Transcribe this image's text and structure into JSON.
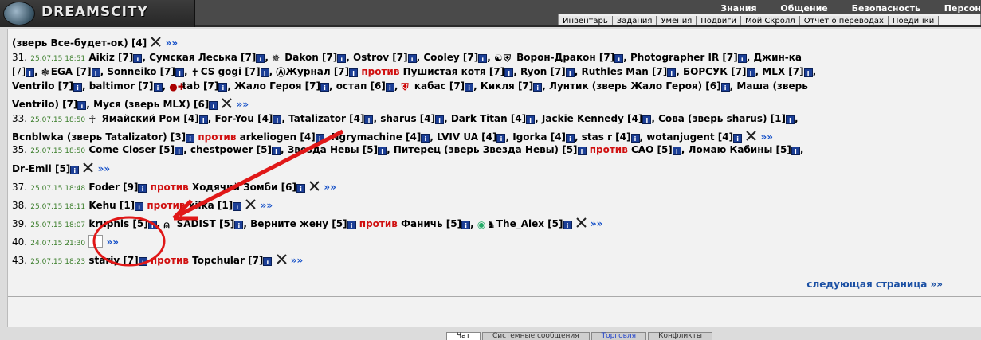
{
  "header": {
    "title": "DREAMSCITY",
    "nav_top": [
      "Знания",
      "Общение",
      "Безопасность",
      "Персон"
    ],
    "nav_sub": [
      "Инвентарь",
      "Задания",
      "Умения",
      "Подвиги",
      "Мой Скролл",
      "Отчет о переводах",
      "Поединки"
    ]
  },
  "lines": [
    {
      "pre": "(зверь Все-будет-ок) [4]",
      "swords": true,
      "tail": "»»"
    },
    {
      "num": "31.",
      "time": "25.07.15 18:51",
      "text": "Aikiz [7]",
      "parts": [
        "Сумская Леська [7]",
        "Dakon [7]",
        "Ostrov [7]",
        "Cooley [7]",
        "Ворон-Дракон [7]",
        "Photographer IR [7]",
        "Джин-ка"
      ]
    },
    {
      "text2": "[7]",
      "parts2": [
        "EGA [7]",
        "Sonneiko [7]",
        "CS gogi [7]",
        "Журнал [7]"
      ],
      "vs": "против",
      "after": "Пушистая котя [7]",
      "parts3": [
        "Ryon [7]",
        "Ruthles Man [7]",
        "БОРСУК [7]",
        "MLX [7]"
      ]
    },
    {
      "parts": [
        "Ventrilo [7]",
        "baltimor [7]",
        "tab [7]",
        "Жало Героя [7]",
        "остап [6]",
        "кабас [7]",
        "Кикля [7]",
        "Лунтик (зверь Жало Героя) [6]",
        "Маша (зверь"
      ]
    },
    {
      "pre": "Ventrilo) [7]",
      "parts": [
        "Муся (зверь MLX) [6]"
      ],
      "swords": true,
      "tail": "»»"
    },
    {
      "num": "33.",
      "time": "25.07.15 18:50",
      "parts": [
        "Ямайский Ром [4]",
        "For-You [4]",
        "Tatalizator [4]",
        "sharus [4]",
        "Dark Titan [4]",
        "Jackie Kennedy [4]",
        "Сова (зверь sharus) [1]"
      ]
    },
    {
      "pre": "Bcnblwka (зверь Tatalizator) [3]",
      "vs": "против",
      "parts": [
        "arkeliogen [4]",
        "Ngrymachine [4]",
        "LVIV UA [4]",
        "Igorka [4]",
        "stas r [4]",
        "wotanjugent [4]"
      ],
      "swords": true,
      "tail": "»»"
    },
    {
      "num": "35.",
      "time": "25.07.15 18:50",
      "parts": [
        "Come Closer [5]",
        "chestpower [5]",
        "Звезда Невы [5]",
        "Питерец (зверь Звезда Невы) [5]"
      ],
      "vs": "против",
      "parts2": [
        "САО [5]",
        "Ломаю Кабины [5]"
      ]
    },
    {
      "pre": "Dr-Emil [5]",
      "swords": true,
      "tail": "»»"
    },
    {
      "num": "37.",
      "time": "25.07.15 18:48",
      "pre": "Foder [9]",
      "vs": "против",
      "after": "Ходячий Зомби [6]",
      "swords": true,
      "tail": "»»"
    },
    {
      "num": "38.",
      "time": "25.07.15 18:11",
      "pre": "Kehu [1]",
      "vs": "против",
      "after": "xilka [1]",
      "swords": true,
      "tail": "»»"
    },
    {
      "num": "39.",
      "time": "25.07.15 18:07",
      "pre": "krupnis [5]",
      "parts": [
        "SADIST [5]",
        "Верните жену [5]"
      ],
      "vs": "против",
      "after": "Фаничь [5]",
      "parts2": [
        "The_Alex [5]"
      ],
      "swords": true,
      "tail": "»»"
    },
    {
      "num": "40.",
      "time": "24.07.15 21:30",
      "tail": "»»"
    },
    {
      "num": "43.",
      "time": "25.07.15 18:23",
      "pre": "stariy [7]",
      "vs": "против",
      "after": "Topchular [7]",
      "swords": true,
      "tail": "»»"
    }
  ],
  "next_page": "следующая страница »»",
  "tabs": [
    "Чат",
    "Системные сообщения",
    "Торговля",
    "Конфликты"
  ],
  "colors": {
    "accent_red": "#d01010",
    "link_blue": "#1a4fa3",
    "time_green": "#3a7d2a",
    "annotation": "#e01818"
  }
}
